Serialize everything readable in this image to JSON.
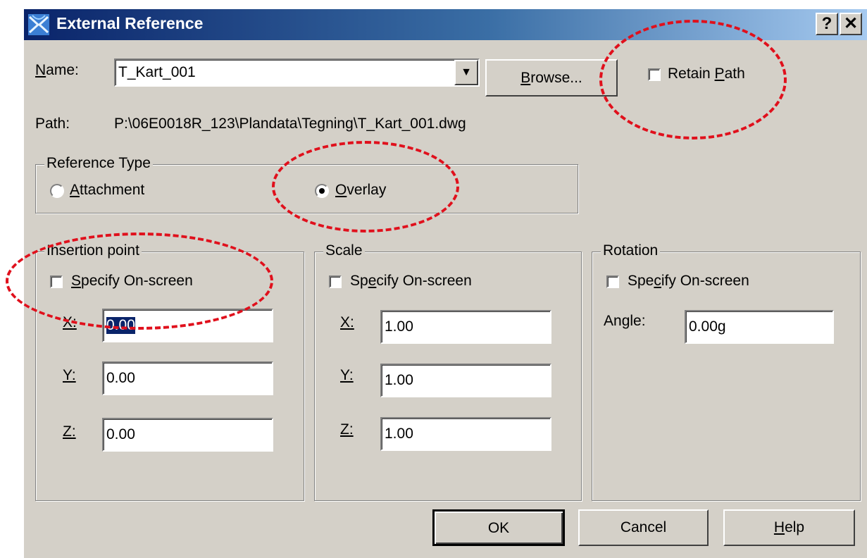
{
  "window": {
    "title": "External Reference",
    "help_btn": "?",
    "close_btn": "✕"
  },
  "name": {
    "label_u": "N",
    "label_rest": "ame:",
    "value": "T_Kart_001",
    "arrow": "▼"
  },
  "browse": {
    "u": "B",
    "rest": "rowse..."
  },
  "retain_path": {
    "pre": "Retain ",
    "u": "P",
    "rest": "ath",
    "checked": false
  },
  "path": {
    "label": "Path:",
    "value": "P:\\06E0018R_123\\Plandata\\Tegning\\T_Kart_001.dwg"
  },
  "reference_type": {
    "title": "Reference Type",
    "attachment": {
      "u": "A",
      "rest": "ttachment",
      "selected": false
    },
    "overlay": {
      "u": "O",
      "rest": "verlay",
      "selected": true
    }
  },
  "insertion": {
    "title": "Insertion point",
    "specify": {
      "u": "S",
      "rest": "pecify On-screen"
    },
    "x_label": "X:",
    "x_value": "0.00",
    "y_label": "Y:",
    "y_value": "0.00",
    "z_label": "Z:",
    "z_value": "0.00"
  },
  "scale": {
    "title": "Scale",
    "specify": {
      "pre": "Sp",
      "u": "e",
      "rest": "cify On-screen"
    },
    "x_label": "X:",
    "x_value": "1.00",
    "y_label": "Y:",
    "y_value": "1.00",
    "z_label": "Z:",
    "z_value": "1.00"
  },
  "rotation": {
    "title": "Rotation",
    "specify": {
      "pre": "Spe",
      "u": "c",
      "rest": "ify On-screen"
    },
    "angle_pre": "An",
    "angle_u": "g",
    "angle_rest": "le:",
    "angle_value": "0.00g"
  },
  "buttons": {
    "ok": "OK",
    "cancel": "Cancel",
    "help_u": "H",
    "help_rest": "elp"
  },
  "annotation_color": "#e0101c"
}
